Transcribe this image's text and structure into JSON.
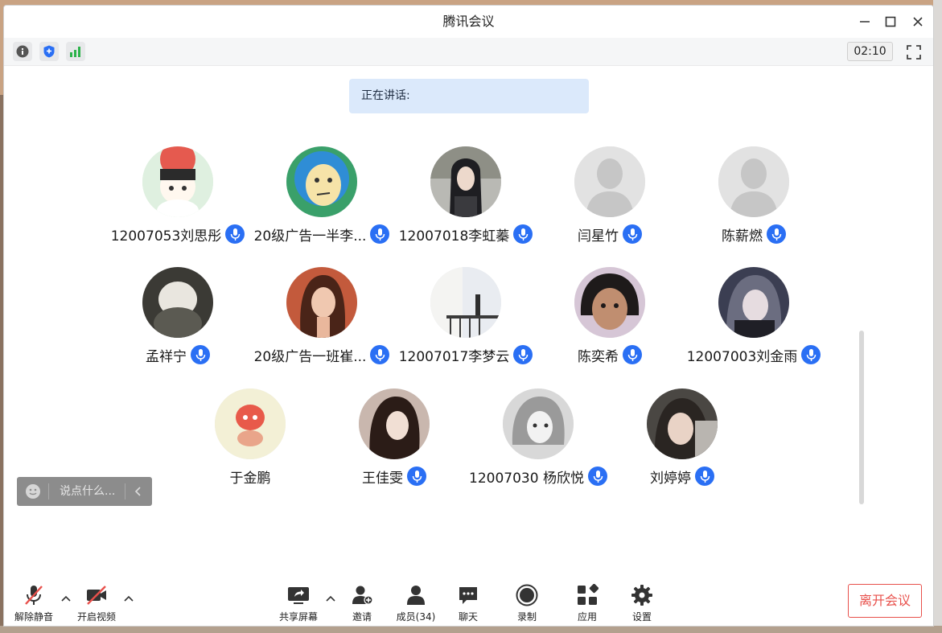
{
  "window": {
    "title": "腾讯会议"
  },
  "toolbar": {
    "timer": "02:10"
  },
  "speaking": {
    "label": "正在讲话:"
  },
  "participants": [
    {
      "name": "12007053刘思彤",
      "mic": true
    },
    {
      "name": "20级广告一半李...",
      "mic": true
    },
    {
      "name": "12007018李虹蓁",
      "mic": true
    },
    {
      "name": "闫星竹",
      "mic": true
    },
    {
      "name": "陈薪燃",
      "mic": true
    },
    {
      "name": "孟祥宁",
      "mic": true
    },
    {
      "name": "20级广告一班崔...",
      "mic": true
    },
    {
      "name": "12007017李梦云",
      "mic": true
    },
    {
      "name": "陈奕希",
      "mic": true
    },
    {
      "name": "12007003刘金雨",
      "mic": true
    },
    {
      "name": "于金鹏",
      "mic": false
    },
    {
      "name": "王佳雯",
      "mic": true
    },
    {
      "name": "12007030 杨欣悦",
      "mic": true
    },
    {
      "name": "刘婷婷",
      "mic": true
    }
  ],
  "chat": {
    "placeholder": "说点什么..."
  },
  "controls": {
    "unmute": "解除静音",
    "start_video": "开启视频",
    "share_screen": "共享屏幕",
    "invite": "邀请",
    "members": "成员(34)",
    "chat": "聊天",
    "record": "录制",
    "apps": "应用",
    "settings": "设置",
    "leave": "离开会议"
  },
  "colors": {
    "accent": "#2a6ff4",
    "leave": "#e8504b",
    "speaking_bg": "#dbe9fb"
  }
}
